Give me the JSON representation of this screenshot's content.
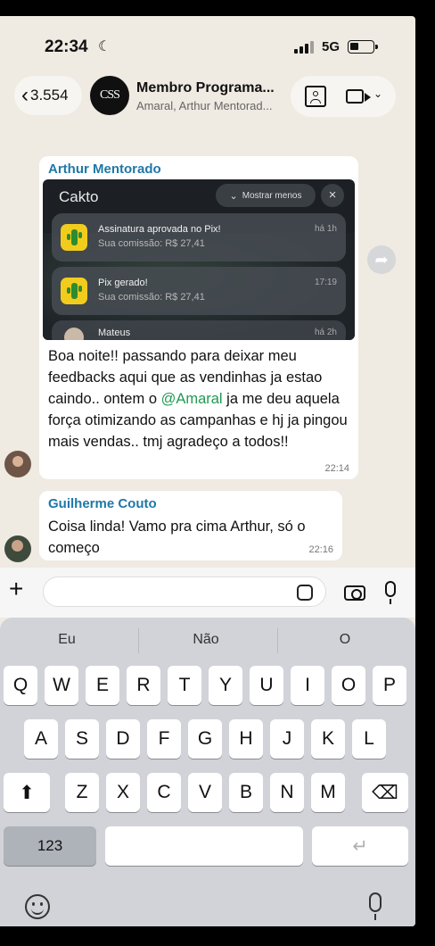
{
  "status_bar": {
    "time": "22:34",
    "network": "5G"
  },
  "header": {
    "back_count": "3.554",
    "avatar_text": "CSS",
    "group_name": "Membro Programa...",
    "members": "Amaral, Arthur Mentorad..."
  },
  "messages": [
    {
      "sender": "Arthur Mentorado",
      "notification_card": {
        "app_name": "Cakto",
        "show_less": "Mostrar menos",
        "items": [
          {
            "title": "Assinatura aprovada no Pix!",
            "subtitle": "Sua comissão: R$ 27,41",
            "when": "há 1h"
          },
          {
            "title": "Pix gerado!",
            "subtitle": "Sua comissão: R$ 27,41",
            "when": "17:19"
          },
          {
            "title": "Mateus",
            "subtitle": "",
            "when": "há 2h"
          }
        ]
      },
      "text_before": "Boa noite!! passando para deixar meu feedbacks aqui que as vendinhas ja estao caindo.. ontem o ",
      "mention": "@Amaral",
      "text_after": " ja me deu aquela força otimizando as campanhas e hj ja pingou mais vendas.. tmj agradeço a todos!!",
      "time": "22:14"
    },
    {
      "sender": "Guilherme Couto",
      "text": "Coisa linda! Vamo pra cima Arthur, só o começo",
      "time": "22:16"
    }
  ],
  "input": {
    "placeholder": ""
  },
  "keyboard": {
    "suggestions": [
      "Eu",
      "Não",
      "O"
    ],
    "row1": [
      "Q",
      "W",
      "E",
      "R",
      "T",
      "Y",
      "U",
      "I",
      "O",
      "P"
    ],
    "row2": [
      "A",
      "S",
      "D",
      "F",
      "G",
      "H",
      "J",
      "K",
      "L"
    ],
    "row3": [
      "Z",
      "X",
      "C",
      "V",
      "B",
      "N",
      "M"
    ],
    "numbers_key": "123",
    "shift_icon": "shift-arrow",
    "delete_icon": "backspace",
    "return_icon": "return-arrow"
  },
  "colors": {
    "sender": "#1f78a8",
    "mention": "#1f9a52",
    "chat_bg": "#efeae2",
    "keyboard_bg": "#d1d3d8",
    "app_icon": "#f2cc1d"
  }
}
